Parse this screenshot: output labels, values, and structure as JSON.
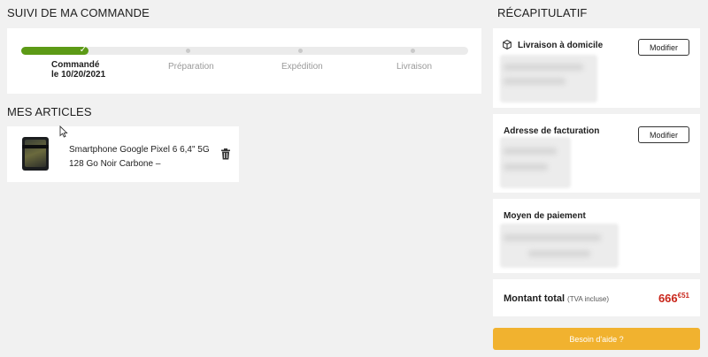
{
  "order_tracking": {
    "title": "SUIVI DE MA COMMANDE",
    "progress_fraction": 0.15,
    "steps": [
      {
        "label_line1": "Commandé",
        "label_line2": "le 10/20/2021",
        "status": "done"
      },
      {
        "label_line1": "Préparation",
        "status": "pending"
      },
      {
        "label_line1": "Expédition",
        "status": "pending"
      },
      {
        "label_line1": "Livraison",
        "status": "pending"
      }
    ]
  },
  "articles": {
    "title": "MES ARTICLES",
    "items": [
      {
        "name": "Smartphone Google Pixel 6 6,4\" 5G 128 Go Noir Carbone –",
        "icon": "trash-icon"
      }
    ]
  },
  "summary": {
    "title": "RÉCAPITULATIF",
    "delivery": {
      "title": "Livraison à domicile",
      "icon": "package-icon",
      "button": "Modifier"
    },
    "billing": {
      "title": "Adresse de facturation",
      "button": "Modifier"
    },
    "payment": {
      "title": "Moyen de paiement"
    },
    "total": {
      "label": "Montant total",
      "tva": "(TVA incluse)",
      "price_main": "666",
      "price_cents": "€51"
    },
    "help_button": "Besoin d'aide ?"
  },
  "colors": {
    "progress": "#5c9a16",
    "price": "#c9261b",
    "help": "#f1b22f"
  }
}
